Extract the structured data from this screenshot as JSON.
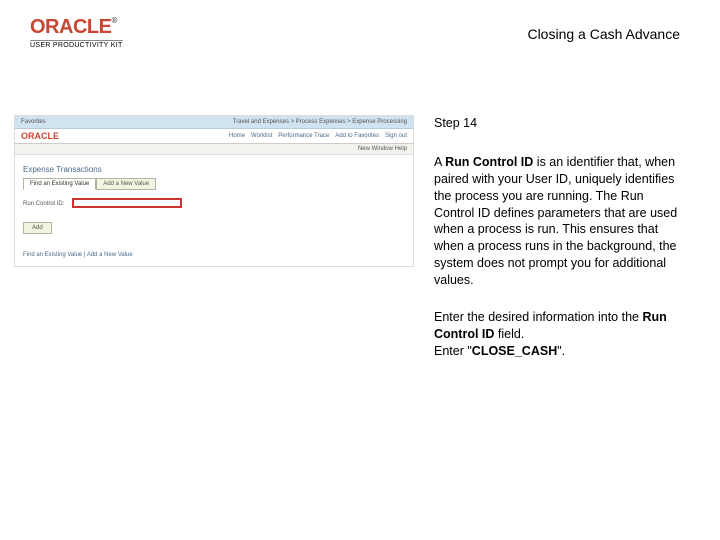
{
  "header": {
    "logo_text": "ORACLE",
    "logo_tm": "®",
    "upk_text": "USER PRODUCTIVITY KIT",
    "page_title": "Closing a Cash Advance"
  },
  "shot": {
    "top_left": "Favorites",
    "top_right": "Travel and Expenses > Process Expenses > Expense Processing",
    "ora_logo": "ORACLE",
    "nav_links": [
      "Home",
      "Worklist",
      "Performance Trace",
      "Add to Favorites",
      "Sign out"
    ],
    "subbar": "New Window  Help",
    "section_title": "Expense Transactions",
    "tab_active": "Find an Existing Value",
    "tab_inactive": "Add a New Value",
    "field_label": "Run Control ID:",
    "btn": "Add",
    "finder": "Find an Existing Value  |  Add a New Value"
  },
  "instructions": {
    "step": "Step 14",
    "p1_a": "A ",
    "p1_b": "Run Control ID",
    "p1_c": " is an identifier that, when paired with your User ID, uniquely identifies the process you are running. The Run Control ID defines parameters that are used when a process is run. This ensures that when a process runs in the background, the system does not prompt you for additional values.",
    "p2_a": "Enter the desired information into the ",
    "p2_b": "Run Control ID",
    "p2_c": " field.",
    "p3_a": "Enter \"",
    "p3_b": "CLOSE_CASH",
    "p3_c": "\"."
  }
}
